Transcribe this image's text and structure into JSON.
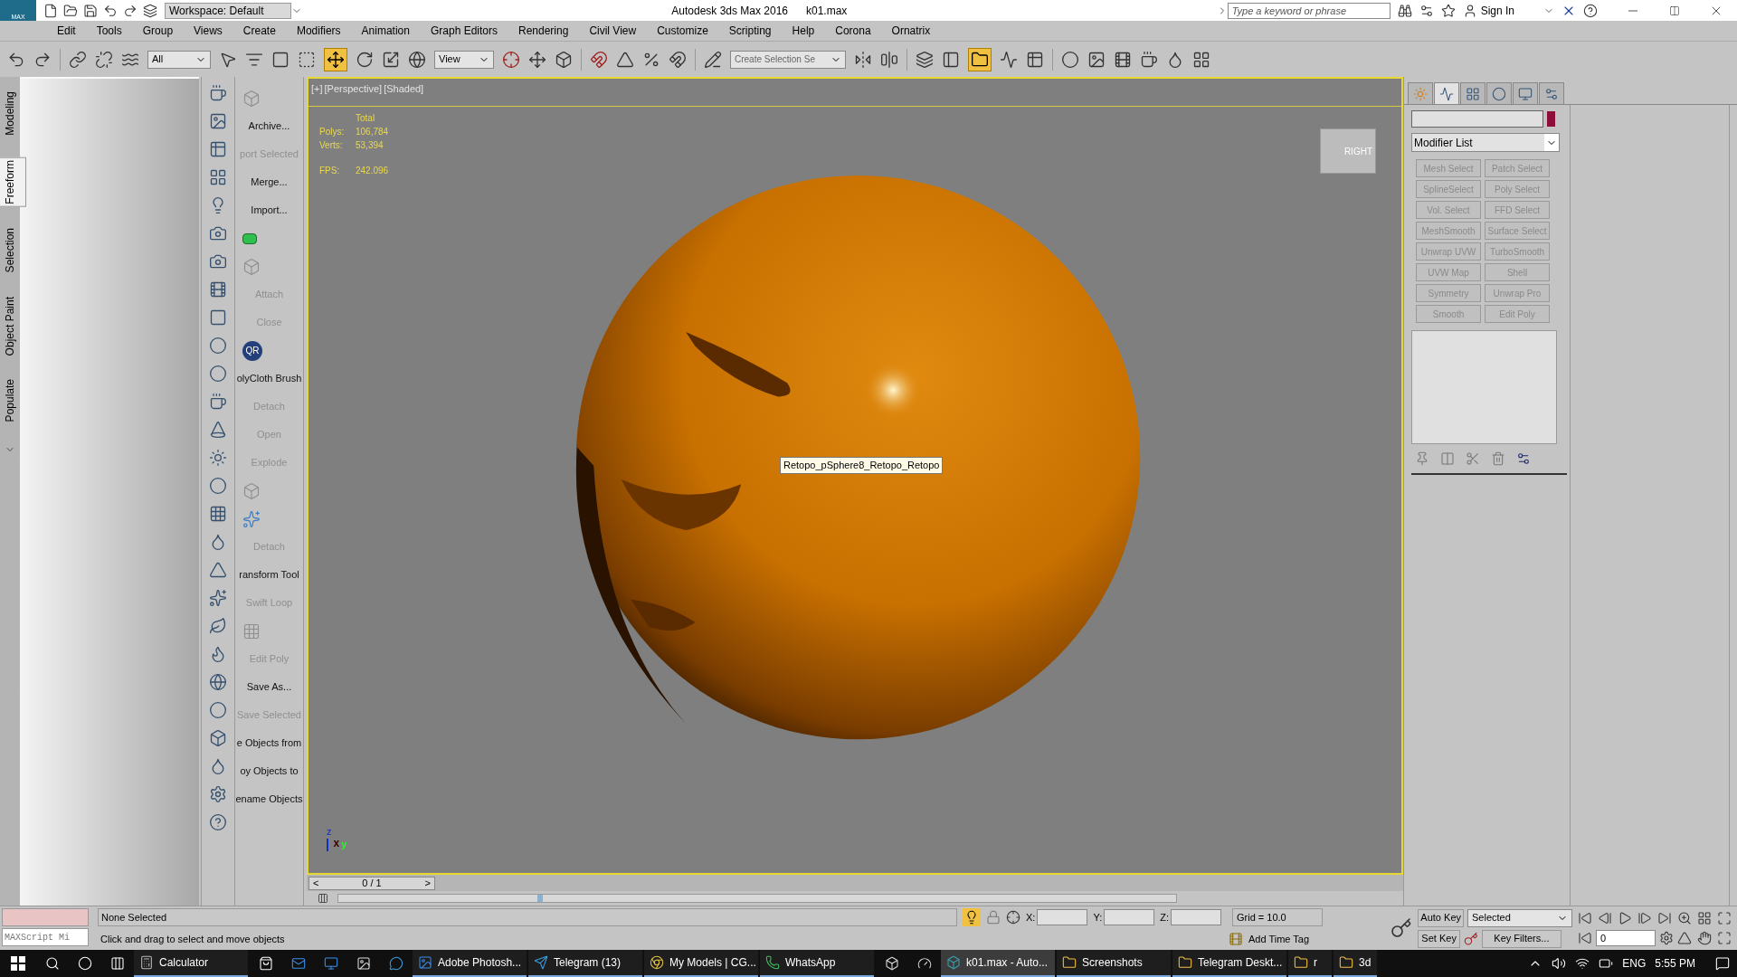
{
  "title_bar": {
    "logo": "MAX",
    "workspace": "Workspace: Default",
    "title": "Autodesk 3ds Max 2016",
    "file": "k01.max",
    "search": {
      "placeholder": "Type a keyword or phrase"
    },
    "sign_in": "Sign In"
  },
  "menu": [
    "Edit",
    "Tools",
    "Group",
    "Views",
    "Create",
    "Modifiers",
    "Animation",
    "Graph Editors",
    "Rendering",
    "Civil View",
    "Customize",
    "Scripting",
    "Help",
    "Corona",
    "Ornatrix"
  ],
  "toolbar": {
    "selection_filter": "All",
    "reference_coord": "View",
    "named_selection": {
      "placeholder": "Create Selection Se"
    }
  },
  "ribbon_tabs": [
    {
      "label": "Modeling",
      "selected": false
    },
    {
      "label": "Freeform",
      "selected": true
    },
    {
      "label": "Selection",
      "selected": false
    },
    {
      "label": "Object Paint",
      "selected": false
    },
    {
      "label": "Populate",
      "selected": false
    }
  ],
  "command_column": [
    {
      "kind": "icon",
      "disabled": true
    },
    {
      "kind": "text",
      "label": "Archive...",
      "disabled": false
    },
    {
      "kind": "text",
      "label": "port Selected",
      "disabled": true
    },
    {
      "kind": "text",
      "label": "Merge...",
      "disabled": false
    },
    {
      "kind": "text",
      "label": "Import...",
      "disabled": false
    },
    {
      "kind": "swatch",
      "disabled": false
    },
    {
      "kind": "icon",
      "disabled": true
    },
    {
      "kind": "text",
      "label": "Attach",
      "disabled": true
    },
    {
      "kind": "text",
      "label": "Close",
      "disabled": true
    },
    {
      "kind": "badge",
      "label": "QR",
      "disabled": false
    },
    {
      "kind": "text",
      "label": "olyCloth Brush",
      "disabled": false
    },
    {
      "kind": "text",
      "label": "Detach",
      "disabled": true
    },
    {
      "kind": "text",
      "label": "Open",
      "disabled": true
    },
    {
      "kind": "text",
      "label": "Explode",
      "disabled": true
    },
    {
      "kind": "icon",
      "disabled": true
    },
    {
      "kind": "dots",
      "disabled": false
    },
    {
      "kind": "text",
      "label": "Detach",
      "disabled": true
    },
    {
      "kind": "text",
      "label": "ransform Tool",
      "disabled": false
    },
    {
      "kind": "text",
      "label": "Swift Loop",
      "disabled": true
    },
    {
      "kind": "grid",
      "disabled": true
    },
    {
      "kind": "text",
      "label": "Edit Poly",
      "disabled": true
    },
    {
      "kind": "text",
      "label": "Save As...",
      "disabled": false
    },
    {
      "kind": "text",
      "label": "Save Selected",
      "disabled": true
    },
    {
      "kind": "text",
      "label": "e Objects from",
      "disabled": false
    },
    {
      "kind": "text",
      "label": "oy Objects to",
      "disabled": false
    },
    {
      "kind": "text",
      "label": "ename Objects",
      "disabled": false
    }
  ],
  "viewport": {
    "labels": [
      "[+]",
      "[Perspective]",
      "[Shaded]"
    ],
    "stats": {
      "heading": "Total",
      "rows": [
        {
          "label": "Polys:",
          "value": "106,784"
        },
        {
          "label": "Verts:",
          "value": "53,394"
        },
        {
          "label": "FPS:",
          "value": "242.096"
        }
      ]
    },
    "tooltip": "Retopo_pSphere8_Retopo_Retopo",
    "viewcube": "RIGHT",
    "axes": [
      "z",
      "x",
      "y"
    ]
  },
  "timeline": {
    "prev": "<",
    "frame": "0 / 1",
    "next": ">"
  },
  "command_panel": {
    "tabs": [
      {
        "selected": false
      },
      {
        "selected": true
      },
      {
        "selected": false
      },
      {
        "selected": false
      },
      {
        "selected": false
      },
      {
        "selected": false
      }
    ],
    "modifier_list": "Modifier List",
    "modifiers": [
      {
        "label": "Mesh Select",
        "disabled": true
      },
      {
        "label": "Patch Select",
        "disabled": true
      },
      {
        "label": "SplineSelect",
        "disabled": true
      },
      {
        "label": "Poly Select",
        "disabled": true
      },
      {
        "label": "Vol. Select",
        "disabled": true
      },
      {
        "label": "FFD Select",
        "disabled": true
      },
      {
        "label": "MeshSmooth",
        "disabled": true
      },
      {
        "label": "Surface Select",
        "disabled": true
      },
      {
        "label": "Unwrap UVW",
        "disabled": true
      },
      {
        "label": "TurboSmooth",
        "disabled": true
      },
      {
        "label": "UVW Map",
        "disabled": true
      },
      {
        "label": "Shell",
        "disabled": true
      },
      {
        "label": "Symmetry",
        "disabled": true
      },
      {
        "label": "Unwrap Pro",
        "disabled": true
      },
      {
        "label": "Smooth",
        "disabled": true
      },
      {
        "label": "Edit Poly",
        "disabled": true
      }
    ]
  },
  "status_bar": {
    "maxscript": {
      "placeholder": "MAXScript Mi"
    },
    "selection": "None Selected",
    "prompt": "Click and drag to select and move objects",
    "coords": [
      "X:",
      "Y:",
      "Z:"
    ],
    "grid": "Grid = 10.0",
    "time_tag": "Add Time Tag",
    "auto_key": "Auto Key",
    "key_mode": "Selected",
    "set_key": "Set Key",
    "key_filters": "Key Filters...",
    "frame": "0"
  },
  "taskbar": {
    "apps": [
      {
        "label": "Calculator",
        "selected": false
      },
      {
        "label": "Adobe Photosh...",
        "selected": false
      },
      {
        "label": "Telegram (13)",
        "selected": false
      },
      {
        "label": "My Models | CG...",
        "selected": false
      },
      {
        "label": "WhatsApp",
        "selected": false
      },
      {
        "label": "k01.max - Auto...",
        "selected": true
      },
      {
        "label": "Screenshots",
        "selected": false
      },
      {
        "label": "Telegram Deskt...",
        "selected": false
      },
      {
        "label": "r",
        "selected": false
      },
      {
        "label": "3d",
        "selected": false
      }
    ],
    "language": "ENG",
    "time": "5:55 PM"
  }
}
